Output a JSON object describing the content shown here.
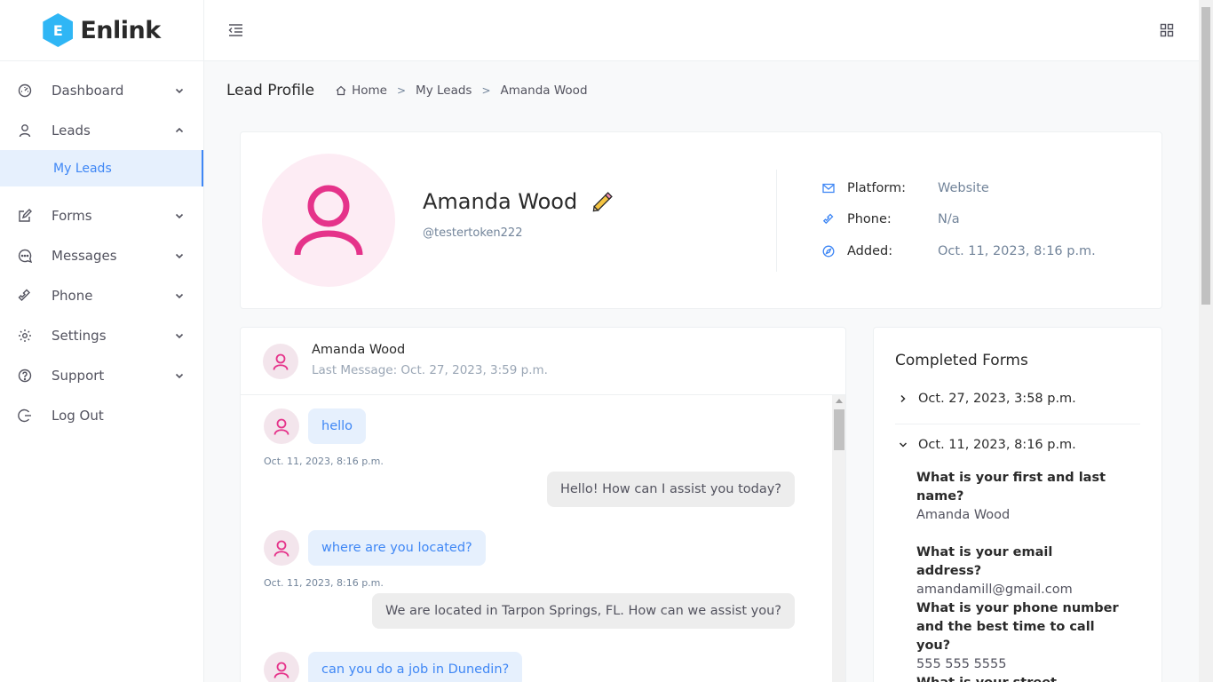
{
  "app": {
    "logo_letter": "E",
    "logo_text": "Enlink"
  },
  "sidebar": {
    "items": [
      {
        "label": "Dashboard",
        "icon": "dashboard-icon"
      },
      {
        "label": "Leads",
        "icon": "user-icon"
      },
      {
        "label": "Forms",
        "icon": "edit-icon"
      },
      {
        "label": "Messages",
        "icon": "message-icon"
      },
      {
        "label": "Phone",
        "icon": "phone-icon"
      },
      {
        "label": "Settings",
        "icon": "gear-icon"
      },
      {
        "label": "Support",
        "icon": "question-icon"
      },
      {
        "label": "Log Out",
        "icon": "logout-icon"
      }
    ],
    "sub_item": "My Leads"
  },
  "page": {
    "title": "Lead Profile",
    "breadcrumb": [
      "Home",
      "My Leads",
      "Amanda Wood"
    ]
  },
  "profile": {
    "name": "Amanda Wood",
    "handle": "@testertoken222",
    "platform_label": "Platform:",
    "platform_value": "Website",
    "phone_label": "Phone:",
    "phone_value": "N/a",
    "added_label": "Added:",
    "added_value": "Oct. 11, 2023, 8:16 p.m."
  },
  "conversation": {
    "name": "Amanda Wood",
    "last_message": "Last Message: Oct. 27, 2023, 3:59 p.m.",
    "messages": [
      {
        "text": "hello",
        "time": "Oct. 11, 2023, 8:16 p.m."
      },
      {
        "text": "Hello! How can I assist you today?"
      },
      {
        "text": "where are you located?",
        "time": "Oct. 11, 2023, 8:16 p.m."
      },
      {
        "text": "We are located in Tarpon Springs, FL. How can we assist you?"
      },
      {
        "text": "can you do a job in Dunedin?"
      }
    ]
  },
  "forms": {
    "title": "Completed Forms",
    "entries": [
      "Oct. 27, 2023, 3:58 p.m.",
      "Oct. 11, 2023, 8:16 p.m."
    ],
    "qa": [
      {
        "q": "What is your first and last name?",
        "a": "Amanda Wood"
      },
      {
        "q": "What is your email address?",
        "a": "amandamill@gmail.com"
      },
      {
        "q": "What is your phone number and the best time to call you?",
        "a": "555 555 5555"
      },
      {
        "q": "What is your street address?",
        "a": ""
      }
    ]
  },
  "colors": {
    "accent": "#3f87f5",
    "avatar_pink": "#e5338a",
    "logo_blue": "#2fb6f5"
  }
}
